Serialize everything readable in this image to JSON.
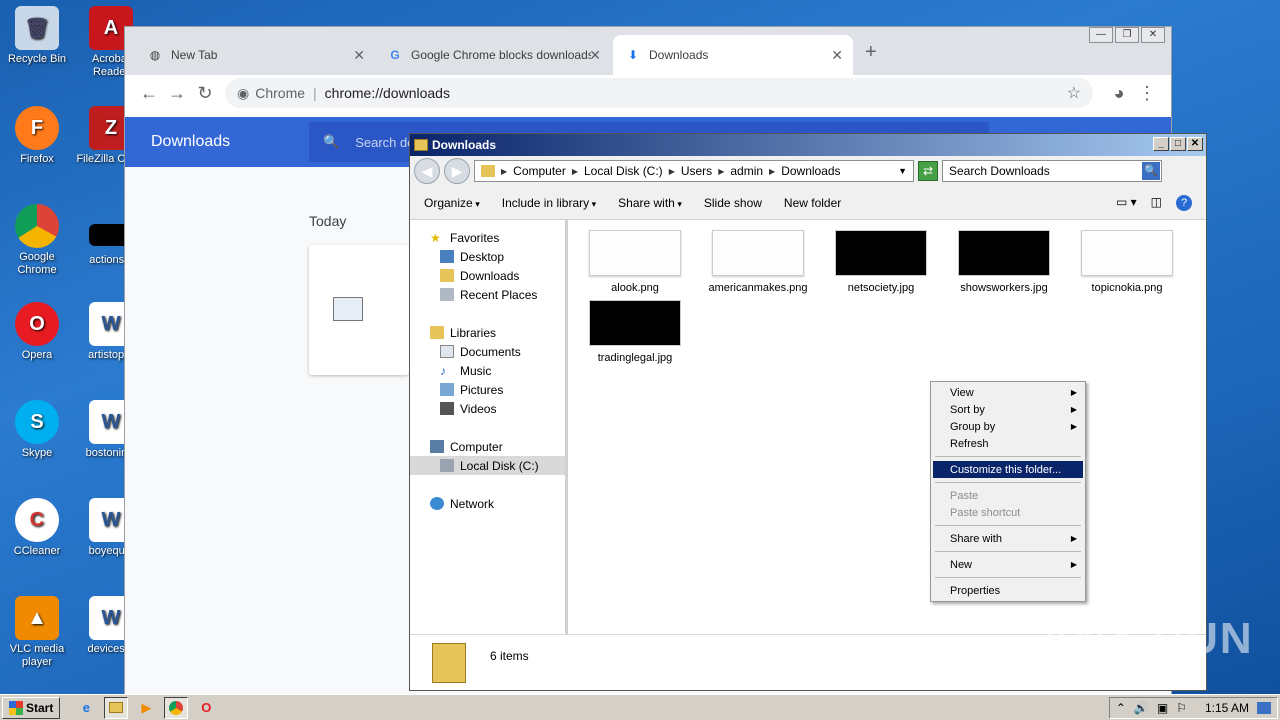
{
  "desktop": {
    "icons": [
      {
        "label": "Recycle Bin",
        "icon": "recycle-bin-icon"
      },
      {
        "label": "Acrobat Reader",
        "icon": "acrobat-icon"
      },
      {
        "label": "Firefox",
        "icon": "firefox-icon"
      },
      {
        "label": "FileZilla Client",
        "icon": "filezilla-icon"
      },
      {
        "label": "Google Chrome",
        "icon": "chrome-icon"
      },
      {
        "label": "actionspi",
        "icon": "file-icon"
      },
      {
        "label": "Opera",
        "icon": "opera-icon"
      },
      {
        "label": "artistoper",
        "icon": "word-doc-icon"
      },
      {
        "label": "Skype",
        "icon": "skype-icon"
      },
      {
        "label": "bostonimp",
        "icon": "word-doc-icon"
      },
      {
        "label": "CCleaner",
        "icon": "ccleaner-icon"
      },
      {
        "label": "boyequip",
        "icon": "word-doc-icon"
      },
      {
        "label": "VLC media player",
        "icon": "vlc-icon"
      },
      {
        "label": "devicesre",
        "icon": "word-doc-icon"
      }
    ]
  },
  "chrome": {
    "tabs": [
      {
        "title": "New Tab",
        "icon": "globe-icon"
      },
      {
        "title": "Google Chrome blocks downloads - G",
        "icon": "google-icon"
      },
      {
        "title": "Downloads",
        "icon": "download-icon"
      }
    ],
    "new_tab": "+",
    "omnibox_prefix": "Chrome",
    "url": "chrome://downloads",
    "page_title": "Downloads",
    "search_placeholder": "Search downloads",
    "section_today": "Today"
  },
  "explorer": {
    "title": "Downloads",
    "breadcrumbs": [
      "Computer",
      "Local Disk (C:)",
      "Users",
      "admin",
      "Downloads"
    ],
    "search_placeholder": "Search Downloads",
    "commands": [
      "Organize",
      "Include in library",
      "Share with",
      "Slide show",
      "New folder"
    ],
    "nav": {
      "favorites": "Favorites",
      "favorites_items": [
        "Desktop",
        "Downloads",
        "Recent Places"
      ],
      "libraries": "Libraries",
      "libraries_items": [
        "Documents",
        "Music",
        "Pictures",
        "Videos"
      ],
      "computer": "Computer",
      "computer_items": [
        "Local Disk (C:)"
      ],
      "network": "Network"
    },
    "files": [
      {
        "name": "alook.png",
        "thumb": "white"
      },
      {
        "name": "americanmakes.png",
        "thumb": "white"
      },
      {
        "name": "netsociety.jpg",
        "thumb": "black"
      },
      {
        "name": "showsworkers.jpg",
        "thumb": "black"
      },
      {
        "name": "topicnokia.png",
        "thumb": "white"
      },
      {
        "name": "tradinglegal.jpg",
        "thumb": "black"
      }
    ],
    "status": "6 items"
  },
  "context_menu": {
    "items": [
      {
        "label": "View",
        "submenu": true
      },
      {
        "label": "Sort by",
        "submenu": true
      },
      {
        "label": "Group by",
        "submenu": true
      },
      {
        "label": "Refresh"
      },
      {
        "label": "Customize this folder..."
      },
      {
        "label": "Paste"
      },
      {
        "label": "Paste shortcut"
      },
      {
        "label": "Share with",
        "submenu": true
      },
      {
        "label": "New",
        "submenu": true
      },
      {
        "label": "Properties"
      }
    ]
  },
  "taskbar": {
    "start": "Start",
    "clock": "1:15 AM"
  },
  "watermark": "ANY RUN"
}
